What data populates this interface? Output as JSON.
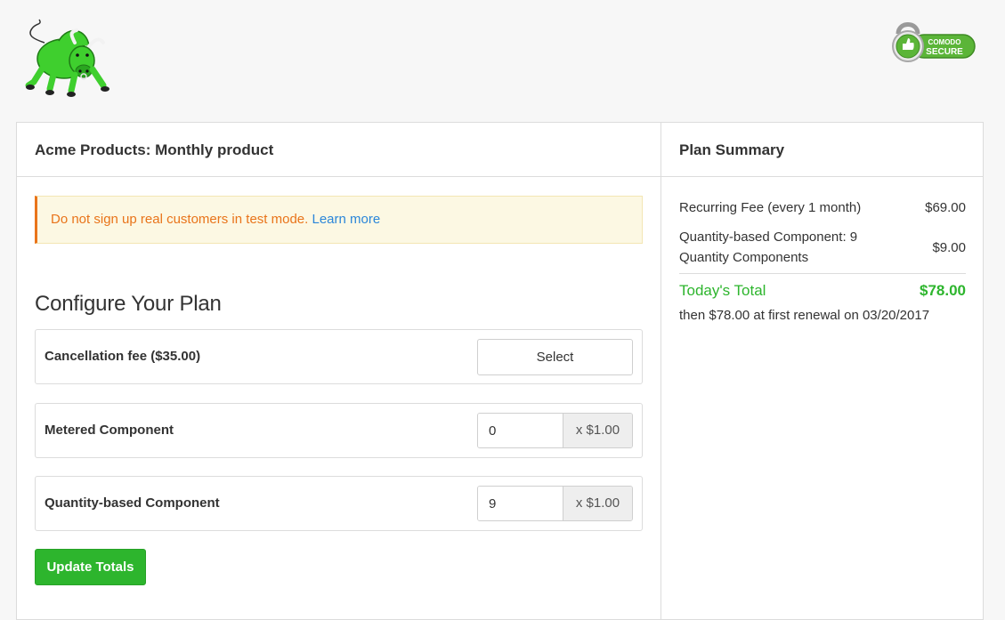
{
  "header": {
    "logo_icon": "green-bull-logo",
    "badge": {
      "icon": "padlock-thumbs-up-icon",
      "line1": "COMODO",
      "line2": "SECURE"
    }
  },
  "product": {
    "title": "Acme Products: Monthly product"
  },
  "alert": {
    "message": "Do not sign up real customers in test mode.",
    "link_text": "Learn more"
  },
  "configure": {
    "title": "Configure Your Plan",
    "components": [
      {
        "label": "Cancellation fee ($35.00)",
        "button_label": "Select"
      },
      {
        "label": "Metered Component",
        "value": "0",
        "unit_price": "x $1.00"
      },
      {
        "label": "Quantity-based Component",
        "value": "9",
        "unit_price": "x $1.00"
      }
    ],
    "update_button": "Update Totals"
  },
  "summary": {
    "title": "Plan Summary",
    "line_items": [
      {
        "label": "Recurring Fee (every 1 month)",
        "amount": "$69.00"
      },
      {
        "label_line1": "Quantity-based Component: 9",
        "label_line2": "Quantity Components",
        "amount": "$9.00"
      }
    ],
    "total_label": "Today's Total",
    "total_amount": "$78.00",
    "renewal_text": "then $78.00 at first renewal on 03/20/2017"
  },
  "colors": {
    "accent_green": "#2db52d",
    "warning_orange": "#e9741a",
    "link_blue": "#2b86d9"
  }
}
